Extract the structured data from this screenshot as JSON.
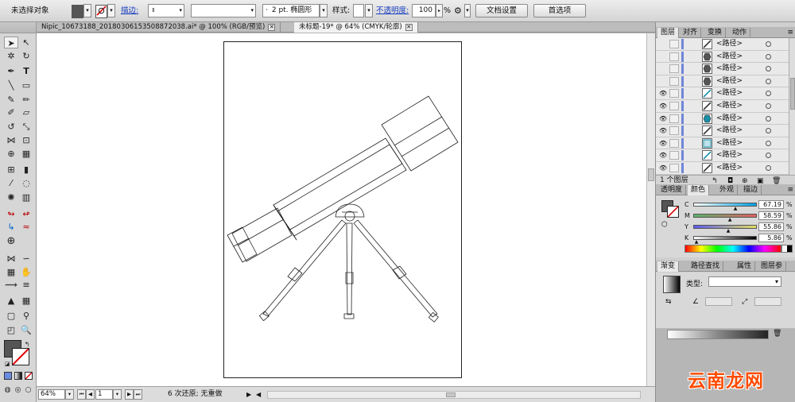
{
  "control_bar": {
    "selection_status": "未选择对象",
    "stroke_label": "描边:",
    "brush_value": "2 pt. 椭圆形",
    "style_label": "样式:",
    "opacity_label": "不透明度:",
    "opacity_value": "100",
    "opacity_unit": "%",
    "doc_setup_button": "文档设置",
    "prefs_button": "首选项",
    "fill_color": "#555555"
  },
  "doc_tabs": [
    {
      "label": "Nipic_10673188_20180306153508872038.ai* @ 100% (RGB/预览)"
    },
    {
      "label": "未标题-19* @ 64% (CMYK/轮廓)"
    }
  ],
  "status_bar": {
    "zoom": "64%",
    "artboard_number": "1",
    "history_text": "6 次还原; 无重做"
  },
  "layers_panel": {
    "tabs": [
      "图层",
      "对齐",
      "变换",
      "动作"
    ],
    "active_tab": "图层",
    "rows": [
      {
        "name": "<路径>",
        "visible": false,
        "thumb": "diag"
      },
      {
        "name": "<路径>",
        "visible": false,
        "thumb": "hex"
      },
      {
        "name": "<路径>",
        "visible": false,
        "thumb": "hex"
      },
      {
        "name": "<路径>",
        "visible": false,
        "thumb": "hex"
      },
      {
        "name": "<路径>",
        "visible": true,
        "thumb": "teal-diag"
      },
      {
        "name": "<路径>",
        "visible": true,
        "thumb": "diag"
      },
      {
        "name": "<路径>",
        "visible": true,
        "thumb": "teal-hex"
      },
      {
        "name": "<路径>",
        "visible": true,
        "thumb": "diag"
      },
      {
        "name": "<路径>",
        "visible": true,
        "thumb": "teal-box"
      },
      {
        "name": "<路径>",
        "visible": true,
        "thumb": "teal-diag"
      },
      {
        "name": "<路径>",
        "visible": true,
        "thumb": "diag"
      }
    ],
    "layer_count": "1 个图层"
  },
  "color_panel": {
    "tabs": [
      "透明度",
      "颜色",
      "外观",
      "描边"
    ],
    "active_tab": "颜色",
    "channels": [
      {
        "label": "C",
        "value": "67.19",
        "unit": "%",
        "fraction": 0.6719,
        "from": "#ffffff",
        "to": "#00a0e0"
      },
      {
        "label": "M",
        "value": "58.59",
        "unit": "%",
        "fraction": 0.5859,
        "from": "#5ab36a",
        "to": "#e06060"
      },
      {
        "label": "Y",
        "value": "55.86",
        "unit": "%",
        "fraction": 0.5586,
        "from": "#5a5af0",
        "to": "#e0e060"
      },
      {
        "label": "K",
        "value": "5.86",
        "unit": "%",
        "fraction": 0.0586,
        "from": "#ffffff",
        "to": "#000000"
      }
    ]
  },
  "gradient_panel": {
    "tabs": [
      "渐变",
      "路径查找",
      "属性",
      "图层参"
    ],
    "active_tab": "渐变",
    "type_label": "类型:"
  },
  "watermark": "云南龙网"
}
